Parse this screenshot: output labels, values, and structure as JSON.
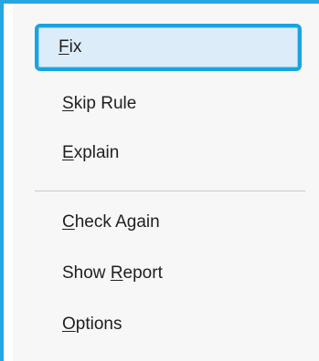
{
  "colors": {
    "accent": "#27a7e1",
    "selection_border": "#1aa3e0",
    "selection_fill": "#dcecf8",
    "menu_background": "#f7f7f7",
    "text": "#1f1f1f",
    "separator": "#c9c9c9"
  },
  "menu": {
    "items": [
      {
        "accel": "F",
        "rest": "ix",
        "selected": true
      },
      {
        "accel": "S",
        "rest": "kip Rule",
        "selected": false
      },
      {
        "accel": "E",
        "rest": "xplain",
        "selected": false
      },
      {
        "accel": "C",
        "rest": "heck Again",
        "selected": false
      },
      {
        "prefix": "Show ",
        "accel": "R",
        "rest": "eport",
        "selected": false
      },
      {
        "accel": "O",
        "rest": "ptions",
        "selected": false
      }
    ]
  }
}
